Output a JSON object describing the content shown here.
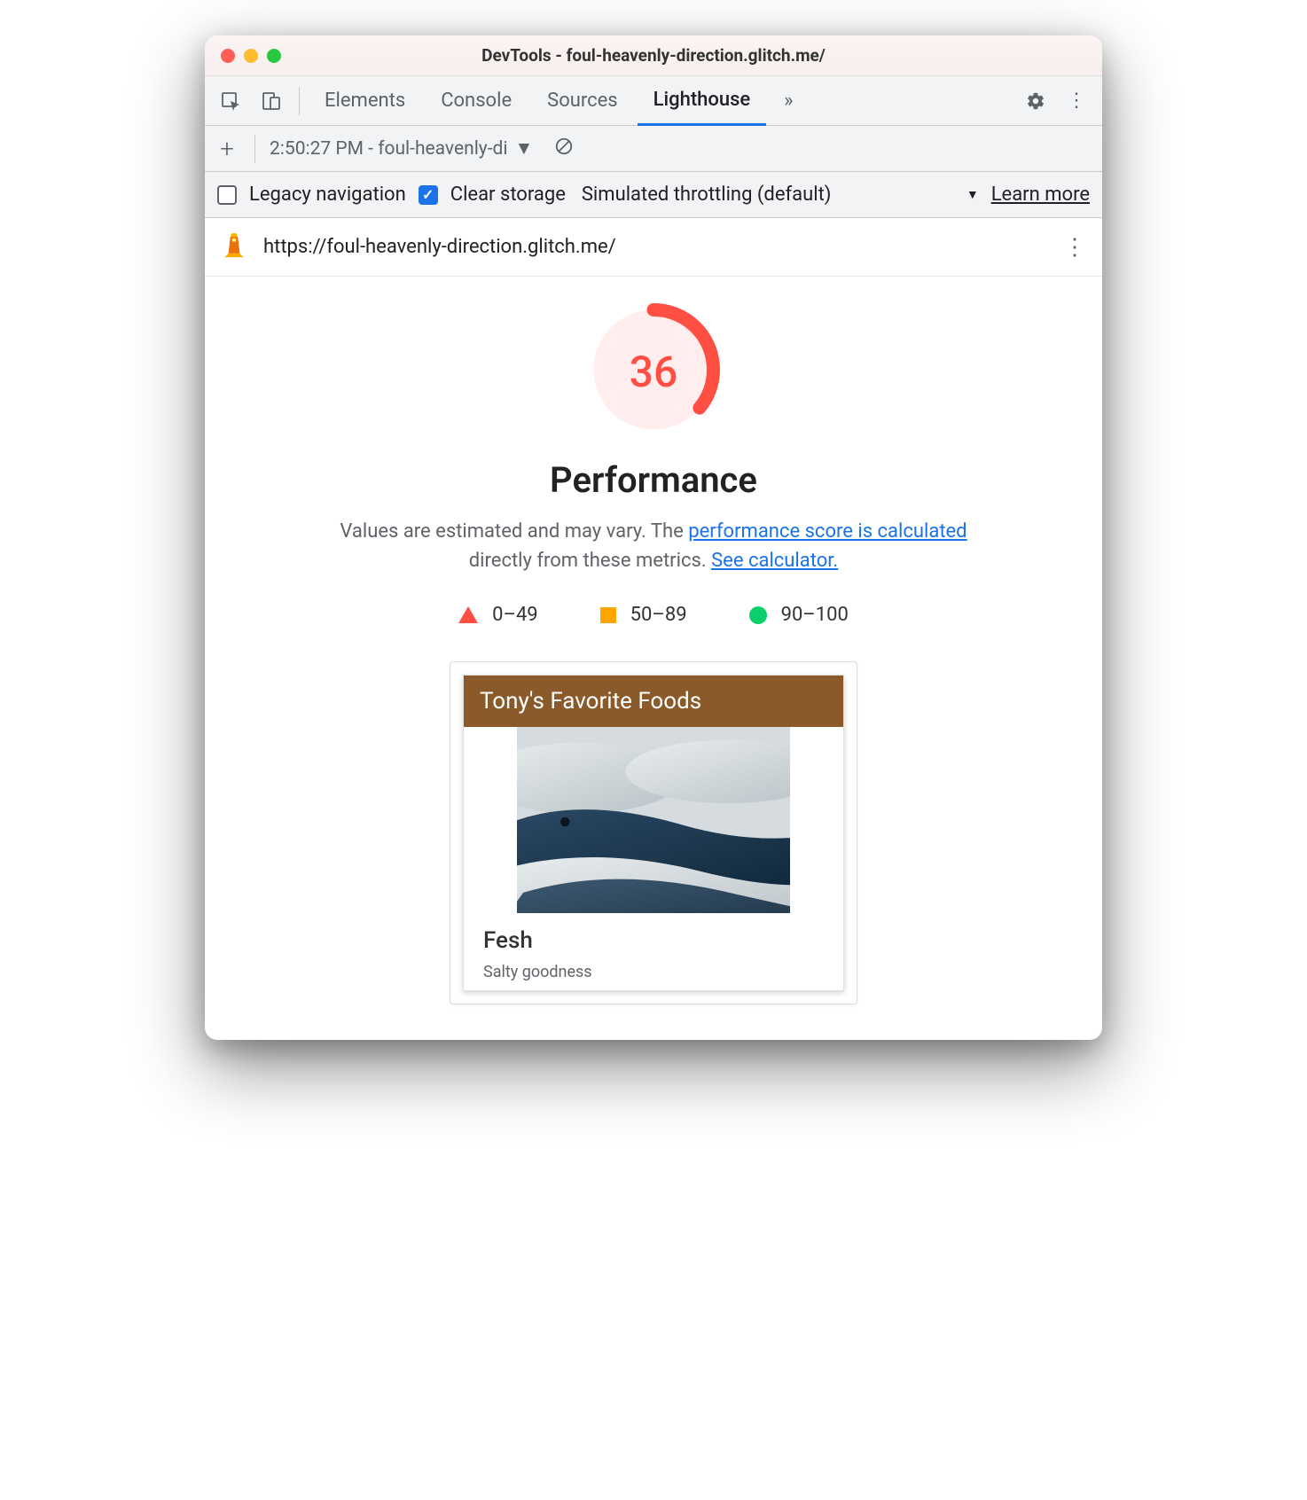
{
  "window": {
    "title": "DevTools - foul-heavenly-direction.glitch.me/"
  },
  "tabs": {
    "items": [
      "Elements",
      "Console",
      "Sources",
      "Lighthouse"
    ],
    "active": "Lighthouse"
  },
  "subbar": {
    "report_label": "2:50:27 PM - foul-heavenly-di"
  },
  "options": {
    "legacy_label": "Legacy navigation",
    "legacy_checked": false,
    "clear_label": "Clear storage",
    "clear_checked": true,
    "throttle_label": "Simulated throttling (default)",
    "learn_more": "Learn more"
  },
  "url_row": {
    "url": "https://foul-heavenly-direction.glitch.me/"
  },
  "report": {
    "score": "36",
    "score_numeric": 36,
    "category": "Performance",
    "desc_prefix": "Values are estimated and may vary. The ",
    "desc_link1": "performance score is calculated",
    "desc_mid": " directly from these metrics. ",
    "desc_link2": "See calculator.",
    "legend": {
      "fail": "0–49",
      "avg": "50–89",
      "pass": "90–100"
    },
    "colors": {
      "fail": "#ff4e42",
      "avg": "#ffa400",
      "pass": "#0cce6b"
    }
  },
  "filmstrip": {
    "page_title": "Tony's Favorite Foods",
    "card_title": "Fesh",
    "card_sub": "Salty goodness"
  }
}
